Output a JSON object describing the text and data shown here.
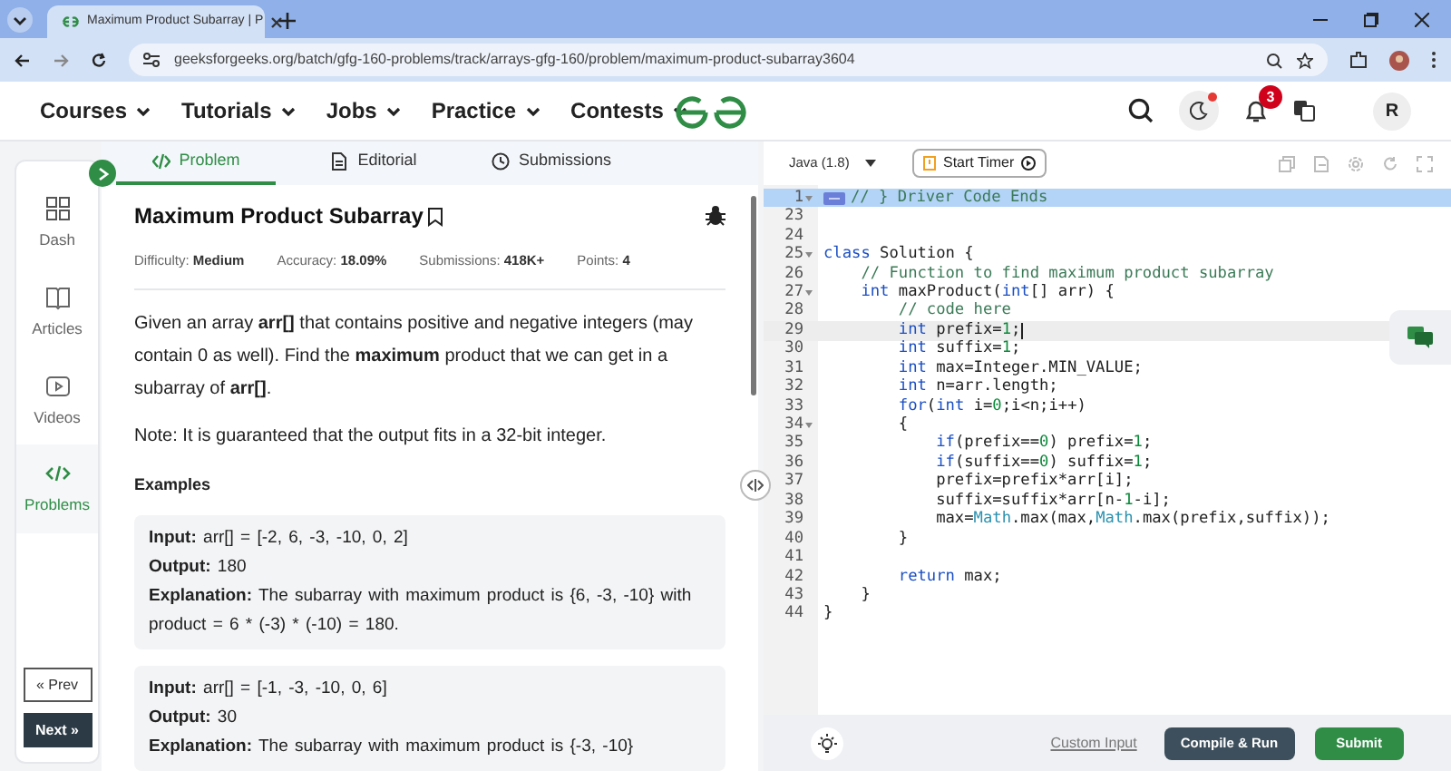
{
  "browser": {
    "tab_title": "Maximum Product Subarray | P",
    "url": "geeksforgeeks.org/batch/gfg-160-problems/track/arrays-gfg-160/problem/maximum-product-subarray3604"
  },
  "nav": {
    "items": [
      {
        "label": "Courses"
      },
      {
        "label": "Tutorials"
      },
      {
        "label": "Jobs"
      },
      {
        "label": "Practice"
      },
      {
        "label": "Contests"
      }
    ],
    "notification_count": "3",
    "avatar": "R"
  },
  "sidebar": {
    "items": [
      {
        "label": "Dash",
        "selected": false
      },
      {
        "label": "Articles",
        "selected": false
      },
      {
        "label": "Videos",
        "selected": false
      },
      {
        "label": "Problems",
        "selected": true
      }
    ],
    "prev": "« Prev",
    "next": "Next »"
  },
  "problem_tabs": [
    {
      "label": "Problem",
      "selected": true
    },
    {
      "label": "Editorial",
      "selected": false
    },
    {
      "label": "Submissions",
      "selected": false
    }
  ],
  "problem": {
    "title": "Maximum Product Subarray",
    "meta": [
      {
        "label": "Difficulty: ",
        "value": "Medium"
      },
      {
        "label": "Accuracy: ",
        "value": "18.09%"
      },
      {
        "label": "Submissions: ",
        "value": "418K+"
      },
      {
        "label": "Points: ",
        "value": "4"
      }
    ],
    "description": "Given an array **arr[]** that contains positive and negative integers (may contain 0 as well). Find the **maximum** product that we can get in a subarray of **arr[]**.",
    "note": "Note: It is guaranteed that the output fits in a 32-bit integer.",
    "examples_heading": "Examples",
    "examples": [
      [
        "**Input:** arr[] = [-2, 6, -3, -10, 0, 2]",
        "**Output:** 180",
        "**Explanation:** The subarray with maximum product is {6, -3, -10} with product = 6 * (-3) * (-10) = 180."
      ],
      [
        "**Input:** arr[] = [-1, -3, -10, 0, 6]",
        "**Output:** 30",
        "**Explanation:** The subarray with maximum product is {-3, -10}"
      ]
    ]
  },
  "editor": {
    "language": "Java (1.8)",
    "timer": "Start Timer",
    "lines": [
      {
        "number": "1",
        "fold": true,
        "collapsed": true,
        "selected": true,
        "cursor": false,
        "tokens": [
          {
            "kind": "comment",
            "text": "// } Driver Code Ends"
          }
        ]
      },
      {
        "number": "23",
        "fold": false,
        "collapsed": false,
        "selected": false,
        "cursor": false
      },
      {
        "number": "24",
        "fold": false,
        "collapsed": false,
        "selected": false,
        "cursor": false
      },
      {
        "number": "25",
        "fold": true,
        "collapsed": false,
        "selected": false,
        "cursor": false,
        "tokens": [
          {
            "kind": "keyword",
            "text": "class"
          },
          {
            "kind": "plain",
            "text": " Solution {"
          }
        ]
      },
      {
        "number": "26",
        "fold": false,
        "collapsed": false,
        "selected": false,
        "cursor": false,
        "tokens": [
          {
            "kind": "comment",
            "text": "    // Function to find maximum product subarray"
          }
        ]
      },
      {
        "number": "27",
        "fold": true,
        "collapsed": false,
        "selected": false,
        "cursor": false,
        "tokens": [
          {
            "kind": "keyword",
            "text": "    int"
          },
          {
            "kind": "plain",
            "text": " maxProduct("
          },
          {
            "kind": "keyword",
            "text": "int"
          },
          {
            "kind": "plain",
            "text": "[] arr) {"
          }
        ]
      },
      {
        "number": "28",
        "fold": false,
        "collapsed": false,
        "selected": false,
        "cursor": false,
        "tokens": [
          {
            "kind": "comment",
            "text": "        // code here"
          }
        ]
      },
      {
        "number": "29",
        "fold": false,
        "collapsed": false,
        "selected": false,
        "cursor": true,
        "tokens": [
          {
            "kind": "keyword",
            "text": "        int"
          },
          {
            "kind": "plain",
            "text": " prefix="
          },
          {
            "kind": "number",
            "text": "1"
          },
          {
            "kind": "plain",
            "text": ";"
          }
        ]
      },
      {
        "number": "30",
        "fold": false,
        "collapsed": false,
        "selected": false,
        "cursor": false,
        "tokens": [
          {
            "kind": "keyword",
            "text": "        int"
          },
          {
            "kind": "plain",
            "text": " suffix="
          },
          {
            "kind": "number",
            "text": "1"
          },
          {
            "kind": "plain",
            "text": ";"
          }
        ]
      },
      {
        "number": "31",
        "fold": false,
        "collapsed": false,
        "selected": false,
        "cursor": false,
        "tokens": [
          {
            "kind": "keyword",
            "text": "        int"
          },
          {
            "kind": "plain",
            "text": " max=Integer.MIN_VALUE;"
          }
        ]
      },
      {
        "number": "32",
        "fold": false,
        "collapsed": false,
        "selected": false,
        "cursor": false,
        "tokens": [
          {
            "kind": "keyword",
            "text": "        int"
          },
          {
            "kind": "plain",
            "text": " n=arr.length;"
          }
        ]
      },
      {
        "number": "33",
        "fold": false,
        "collapsed": false,
        "selected": false,
        "cursor": false,
        "tokens": [
          {
            "kind": "keyword",
            "text": "        for"
          },
          {
            "kind": "plain",
            "text": "("
          },
          {
            "kind": "keyword",
            "text": "int"
          },
          {
            "kind": "plain",
            "text": " i="
          },
          {
            "kind": "number",
            "text": "0"
          },
          {
            "kind": "plain",
            "text": ";i<n;i++)"
          }
        ]
      },
      {
        "number": "34",
        "fold": true,
        "collapsed": false,
        "selected": false,
        "cursor": false,
        "tokens": [
          {
            "kind": "plain",
            "text": "        {"
          }
        ]
      },
      {
        "number": "35",
        "fold": false,
        "collapsed": false,
        "selected": false,
        "cursor": false,
        "tokens": [
          {
            "kind": "keyword",
            "text": "            if"
          },
          {
            "kind": "plain",
            "text": "(prefix=="
          },
          {
            "kind": "number",
            "text": "0"
          },
          {
            "kind": "plain",
            "text": ") prefix="
          },
          {
            "kind": "number",
            "text": "1"
          },
          {
            "kind": "plain",
            "text": ";"
          }
        ]
      },
      {
        "number": "36",
        "fold": false,
        "collapsed": false,
        "selected": false,
        "cursor": false,
        "tokens": [
          {
            "kind": "keyword",
            "text": "            if"
          },
          {
            "kind": "plain",
            "text": "(suffix=="
          },
          {
            "kind": "number",
            "text": "0"
          },
          {
            "kind": "plain",
            "text": ") suffix="
          },
          {
            "kind": "number",
            "text": "1"
          },
          {
            "kind": "plain",
            "text": ";"
          }
        ]
      },
      {
        "number": "37",
        "fold": false,
        "collapsed": false,
        "selected": false,
        "cursor": false,
        "tokens": [
          {
            "kind": "plain",
            "text": "            prefix=prefix*arr[i];"
          }
        ]
      },
      {
        "number": "38",
        "fold": false,
        "collapsed": false,
        "selected": false,
        "cursor": false,
        "tokens": [
          {
            "kind": "plain",
            "text": "            suffix=suffix*arr[n-"
          },
          {
            "kind": "number",
            "text": "1"
          },
          {
            "kind": "plain",
            "text": "-i];"
          }
        ]
      },
      {
        "number": "39",
        "fold": false,
        "collapsed": false,
        "selected": false,
        "cursor": false,
        "tokens": [
          {
            "kind": "plain",
            "text": "            max="
          },
          {
            "kind": "class",
            "text": "Math"
          },
          {
            "kind": "plain",
            "text": ".max(max,"
          },
          {
            "kind": "class",
            "text": "Math"
          },
          {
            "kind": "plain",
            "text": ".max(prefix,suffix));"
          }
        ]
      },
      {
        "number": "40",
        "fold": false,
        "collapsed": false,
        "selected": false,
        "cursor": false,
        "tokens": [
          {
            "kind": "plain",
            "text": "        }"
          }
        ]
      },
      {
        "number": "41",
        "fold": false,
        "collapsed": false,
        "selected": false,
        "cursor": false
      },
      {
        "number": "42",
        "fold": false,
        "collapsed": false,
        "selected": false,
        "cursor": false,
        "tokens": [
          {
            "kind": "keyword",
            "text": "        return"
          },
          {
            "kind": "plain",
            "text": " max;"
          }
        ]
      },
      {
        "number": "43",
        "fold": false,
        "collapsed": false,
        "selected": false,
        "cursor": false,
        "tokens": [
          {
            "kind": "plain",
            "text": "    }"
          }
        ]
      },
      {
        "number": "44",
        "fold": false,
        "collapsed": false,
        "selected": false,
        "cursor": false,
        "tokens": [
          {
            "kind": "plain",
            "text": "}"
          }
        ]
      }
    ],
    "custom_input": "Custom Input",
    "compile": "Compile & Run",
    "submit": "Submit"
  }
}
